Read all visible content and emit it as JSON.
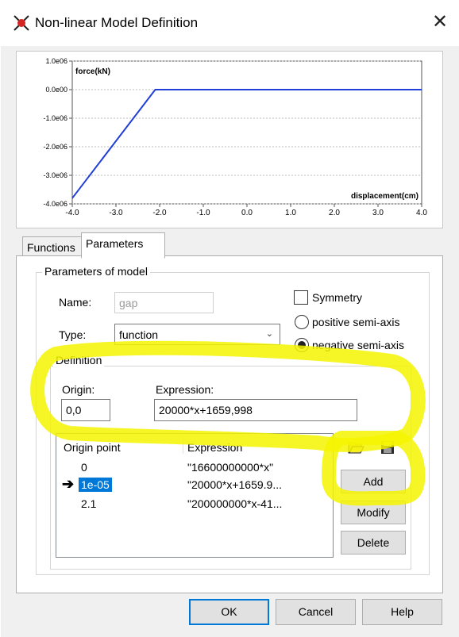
{
  "window": {
    "title": "Non-linear Model Definition",
    "close_glyph": "✕"
  },
  "chart_data": {
    "type": "line",
    "ylabel": "force(kN)",
    "xlabel": "displacement(cm)",
    "xlim": [
      -4.0,
      4.0
    ],
    "ylim": [
      -4000000,
      1000000
    ],
    "x_ticks": [
      "-4.0",
      "-3.0",
      "-2.0",
      "-1.0",
      "0.0",
      "1.0",
      "2.0",
      "3.0",
      "4.0"
    ],
    "y_ticks": [
      "1.0e06",
      "0.0e00",
      "-1.0e06",
      "-2.0e06",
      "-3.0e06",
      "-4.0e06"
    ],
    "series": [
      {
        "x": [
          -4.0,
          -2.1,
          4.0
        ],
        "y": [
          -3800000,
          0,
          0
        ],
        "color": "#1f3fd8"
      }
    ]
  },
  "tabs": [
    {
      "label": "Functions"
    },
    {
      "label": "Parameters"
    }
  ],
  "params": {
    "group_label": "Parameters of model",
    "name_label": "Name:",
    "name_value": "gap",
    "type_label": "Type:",
    "type_value": "function",
    "symmetry_label": "Symmetry",
    "positive_label": "positive semi-axis",
    "negative_label": "negative semi-axis"
  },
  "definition": {
    "group_label": "Definition",
    "origin_label": "Origin:",
    "origin_value": "0,0",
    "expression_label": "Expression:",
    "expression_value": "20000*x+1659,998"
  },
  "table": {
    "headers": [
      "Origin point",
      "Expression"
    ],
    "rows": [
      {
        "origin": "0",
        "expression": "\"16600000000*x\""
      },
      {
        "origin": "1e-05",
        "expression": "\"20000*x+1659.9...",
        "selected": true
      },
      {
        "origin": "2.1",
        "expression": "\"200000000*x-41..."
      }
    ]
  },
  "buttons": {
    "add": "Add",
    "modify": "Modify",
    "delete": "Delete",
    "ok": "OK",
    "cancel": "Cancel",
    "help": "Help"
  },
  "colors": {
    "highlight": "#f5f500",
    "selection": "#0078d7",
    "series": "#1f3fd8"
  }
}
